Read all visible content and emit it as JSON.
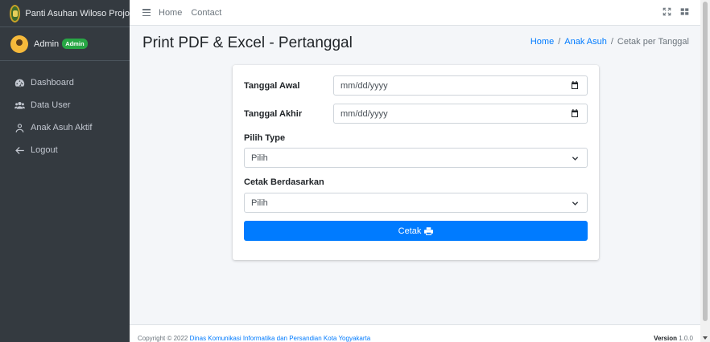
{
  "brand": {
    "name": "Panti Asuhan Wiloso Projo",
    "logo_icon": "emblem-logo"
  },
  "user": {
    "name": "Admin",
    "badge": "Admin",
    "badge_color": "#28a745"
  },
  "sidebar": {
    "items": [
      {
        "label": "Dashboard",
        "icon": "tachometer-icon"
      },
      {
        "label": "Data User",
        "icon": "users-icon"
      },
      {
        "label": "Anak Asuh Aktif",
        "icon": "user-icon"
      },
      {
        "label": "Logout",
        "icon": "arrow-left-icon"
      }
    ]
  },
  "topbar": {
    "links": [
      "Home",
      "Contact"
    ],
    "right_icons": [
      "expand-icon",
      "grid-icon"
    ]
  },
  "page": {
    "title": "Print PDF & Excel - Pertanggal",
    "breadcrumb": [
      "Home",
      "Anak Asuh",
      "Cetak per Tanggal"
    ]
  },
  "form": {
    "tanggal_awal": {
      "label": "Tanggal Awal",
      "placeholder": "mm/dd/yyyy"
    },
    "tanggal_akhir": {
      "label": "Tanggal Akhir",
      "placeholder": "mm/dd/yyyy"
    },
    "pilih_type": {
      "label": "Pilih Type",
      "value": "Pilih"
    },
    "cetak_berdasarkan": {
      "label": "Cetak Berdasarkan",
      "value": "Pilih"
    },
    "submit_label": "Cetak",
    "submit_color": "#007bff"
  },
  "footer": {
    "copyright": "Copyright © 2022",
    "org": "Dinas Komunikasi Informatika dan Persandian Kota Yogyakarta",
    "version_label": "Version",
    "version": "1.0.0"
  },
  "colors": {
    "sidebar_bg": "#343a40",
    "accent": "#007bff",
    "content_bg": "#f4f6f9"
  }
}
